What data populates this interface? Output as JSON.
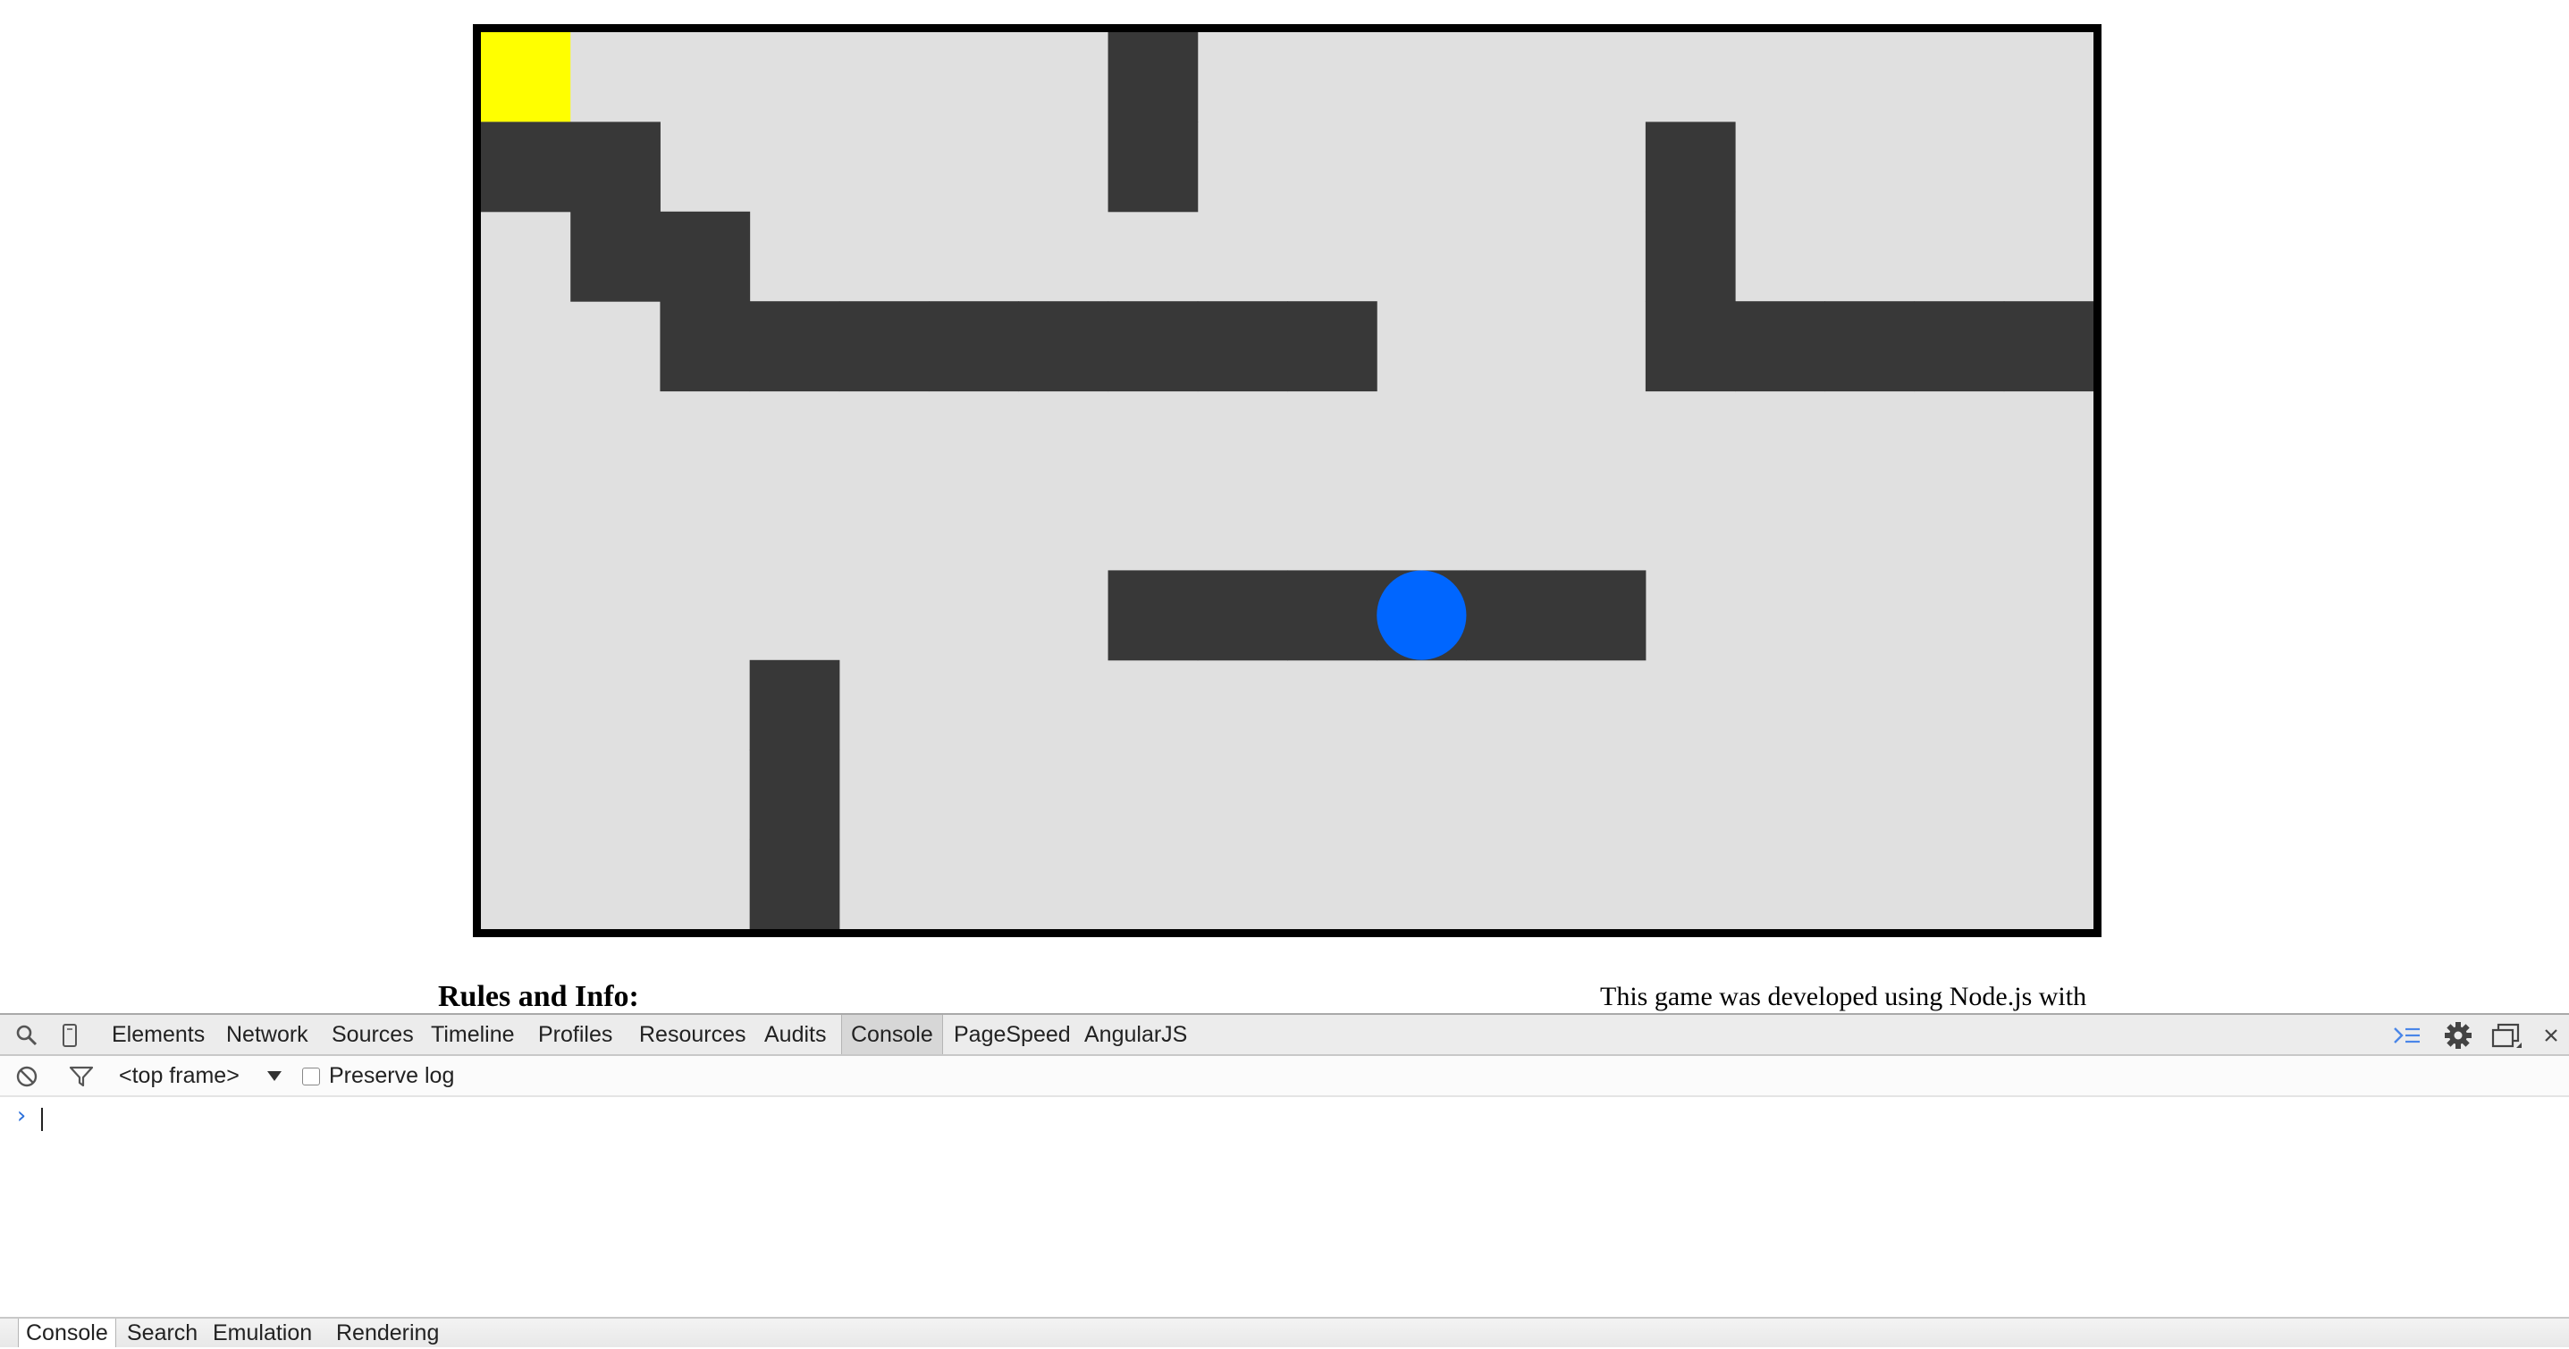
{
  "game": {
    "grid": {
      "cols": 18,
      "rows": 10
    },
    "colors": {
      "floor": "#e0e0e0",
      "wall": "#383838",
      "goal": "#ffff00",
      "player": "#0066ff",
      "border": "#000000"
    },
    "goal_cell": [
      0,
      0
    ],
    "player_cell": [
      10,
      6
    ],
    "walls": [
      [
        7,
        0
      ],
      [
        7,
        1
      ],
      [
        0,
        1
      ],
      [
        1,
        1
      ],
      [
        13,
        1
      ],
      [
        1,
        2
      ],
      [
        2,
        2
      ],
      [
        13,
        2
      ],
      [
        2,
        3
      ],
      [
        3,
        3
      ],
      [
        4,
        3
      ],
      [
        5,
        3
      ],
      [
        6,
        3
      ],
      [
        7,
        3
      ],
      [
        8,
        3
      ],
      [
        9,
        3
      ],
      [
        13,
        3
      ],
      [
        14,
        3
      ],
      [
        15,
        3
      ],
      [
        16,
        3
      ],
      [
        17,
        3
      ],
      [
        7,
        6
      ],
      [
        8,
        6
      ],
      [
        9,
        6
      ],
      [
        10,
        6
      ],
      [
        11,
        6
      ],
      [
        12,
        6
      ],
      [
        3,
        7
      ],
      [
        3,
        8
      ],
      [
        3,
        9
      ]
    ]
  },
  "page": {
    "rules_heading": "Rules and Info:",
    "credits_text": "This game was developed using Node.js with"
  },
  "devtools": {
    "tabs": [
      {
        "label": "Elements"
      },
      {
        "label": "Network"
      },
      {
        "label": "Sources"
      },
      {
        "label": "Timeline"
      },
      {
        "label": "Profiles"
      },
      {
        "label": "Resources"
      },
      {
        "label": "Audits"
      },
      {
        "label": "Console",
        "active": true
      },
      {
        "label": "PageSpeed"
      },
      {
        "label": "AngularJS"
      }
    ],
    "console": {
      "frame_select": "<top frame>",
      "preserve_log_label": "Preserve log",
      "preserve_log_checked": false,
      "prompt": "›"
    },
    "drawer_tabs": [
      {
        "label": "Console",
        "active": true
      },
      {
        "label": "Search"
      },
      {
        "label": "Emulation"
      },
      {
        "label": "Rendering"
      }
    ],
    "icons": [
      "search-icon",
      "device-mode-icon",
      "console-drawer-icon",
      "settings-gear-icon",
      "dock-side-icon",
      "close-icon",
      "clear-console-icon",
      "filter-icon",
      "dropdown-arrow-icon"
    ]
  }
}
